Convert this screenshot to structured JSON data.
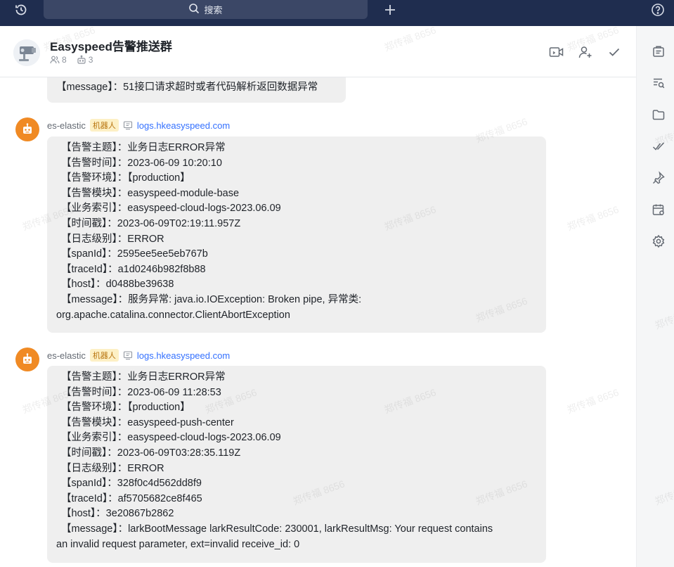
{
  "topbar": {
    "search_label": "搜索"
  },
  "header": {
    "title": "Easyspeed告警推送群",
    "member_count": "8",
    "bot_count": "3"
  },
  "watermark": "郑传福 8656",
  "messages": [
    {
      "sender": "es-elastic",
      "bot_tag": "机器人",
      "link": "logs.hkeasyspeed.com",
      "lines": [
        "【告警主题】：业务日志ERROR异常",
        "【告警时间】：2023-06-09 10:20:10",
        "【告警环境】：【production】",
        "【告警模块】：easyspeed-module-base",
        "【业务索引】：easyspeed-cloud-logs-2023.06.09",
        "【时间戳】：2023-06-09T02:19:11.957Z",
        "【日志级别】：ERROR",
        "【spanId】：2595ee5ee5eb767b",
        "【traceId】：a1d0246b982f8b88",
        "【host】：d0488be39638",
        "【message】：服务异常: java.io.IOException: Broken pipe, 异常类:",
        "org.apache.catalina.connector.ClientAbortException"
      ]
    },
    {
      "sender": "es-elastic",
      "bot_tag": "机器人",
      "link": "logs.hkeasyspeed.com",
      "lines": [
        "【告警主题】：业务日志ERROR异常",
        "【告警时间】：2023-06-09 11:28:53",
        "【告警环境】：【production】",
        "【告警模块】：easyspeed-push-center",
        "【业务索引】：easyspeed-cloud-logs-2023.06.09",
        "【时间戳】：2023-06-09T03:28:35.119Z",
        "【日志级别】：ERROR",
        "【spanId】：328f0c4d562dd8f9",
        "【traceId】：af5705682ce8f465",
        "【host】：3e20867b2862",
        "【message】：larkBootMessage larkResultCode: 230001, larkResultMsg: Your request contains",
        "an invalid request parameter, ext=invalid receive_id: 0"
      ]
    }
  ],
  "previous_message_tail": "【message】：51接口请求超时或者代码解析返回数据异常"
}
